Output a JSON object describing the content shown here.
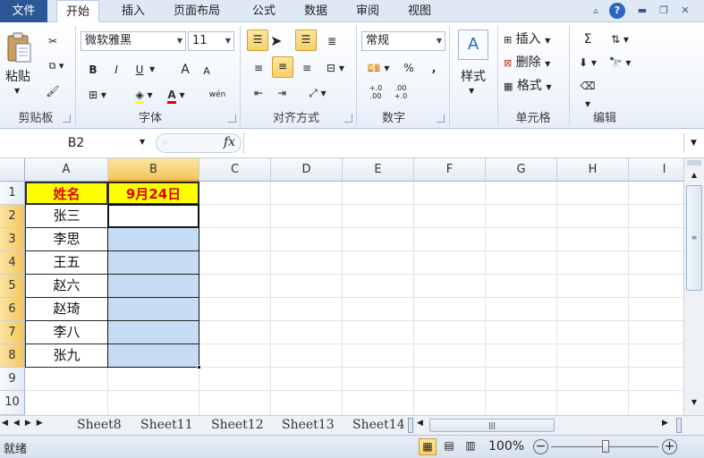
{
  "menu": {
    "file": "文件",
    "tabs": [
      "开始",
      "插入",
      "页面布局",
      "公式",
      "数据",
      "审阅",
      "视图"
    ]
  },
  "ribbon": {
    "clipboard": {
      "paste": "粘贴",
      "label": "剪贴板"
    },
    "font": {
      "name": "微软雅黑",
      "size": "11",
      "label": "字体",
      "bold": "B",
      "italic": "I",
      "underline": "U",
      "grow": "A",
      "shrink": "A",
      "wen": "wén"
    },
    "alignment": {
      "label": "对齐方式"
    },
    "number": {
      "format": "常规",
      "percent": "%",
      "comma": ",",
      "inc": "+.0\n.00",
      "dec": ".00\n+.0",
      "label": "数字"
    },
    "styles": {
      "label": "样式"
    },
    "cells": {
      "insert": "插入",
      "delete": "删除",
      "format": "格式",
      "label": "单元格"
    },
    "editing": {
      "sigma": "Σ",
      "label": "编辑"
    }
  },
  "formula_bar": {
    "name_box": "B2",
    "fx": "fx",
    "value": ""
  },
  "sheet": {
    "columns": [
      "A",
      "B",
      "C",
      "D",
      "E",
      "F",
      "G",
      "H",
      "I"
    ],
    "rows": [
      "1",
      "2",
      "3",
      "4",
      "5",
      "6",
      "7",
      "8",
      "9",
      "10"
    ],
    "header_a": "姓名",
    "header_b": "9月24日",
    "names": [
      "张三",
      "李思",
      "王五",
      "赵六",
      "赵琦",
      "李八",
      "张九"
    ],
    "header_bg": "#ffff00",
    "header_color": "#e00000",
    "selection_color": "#c6dcf5"
  },
  "sheet_tabs": [
    "Sheet8",
    "Sheet11",
    "Sheet12",
    "Sheet13",
    "Sheet14"
  ],
  "status": {
    "ready": "就绪",
    "zoom": "100%"
  }
}
